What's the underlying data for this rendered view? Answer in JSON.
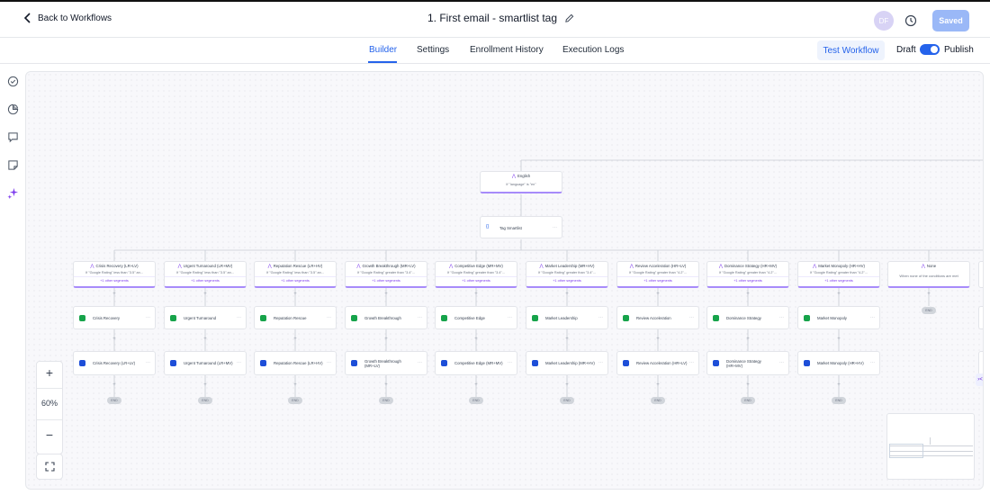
{
  "header": {
    "back_label": "Back to Workflows",
    "title": "1. First email - smartlist tag",
    "avatar_initials": "DF",
    "saved_label": "Saved"
  },
  "tabs": [
    "Builder",
    "Settings",
    "Enrollment History",
    "Execution Logs"
  ],
  "active_tab": "Builder",
  "toolbar": {
    "test_label": "Test Workflow",
    "draft_label": "Draft",
    "publish_label": "Publish",
    "publish_toggle_on": true
  },
  "sidebar_icons": [
    "check-circle-icon",
    "pie-chart-icon",
    "comment-icon",
    "note-icon",
    "sparkle-icon"
  ],
  "colors": {
    "accent": "#2563eb",
    "condition_accent": "#a78bfa",
    "action_green": "#16a34a",
    "tag_blue": "#1d4ed8",
    "saved_button": "#9ab8f7"
  },
  "canvas": {
    "top_condition": {
      "title": "English",
      "subtitle": "If \"language\" is \"en\""
    },
    "top_action": {
      "label": "Tag Smartlist"
    },
    "more_segments_label": "+1 other segments",
    "end_label": "END",
    "branches": [
      {
        "title": "Crisis Recovery (LR+LV)",
        "subtitle": "If \"Google Rating\" less than \"3.5\" an...",
        "action": "Crisis Recovery",
        "tag": "Crisis Recovery (LR+LV)"
      },
      {
        "title": "Urgent Turnaround (LR+MV)",
        "subtitle": "If \"Google Rating\" less than \"3.5\" an...",
        "action": "Urgent Turnaround",
        "tag": "Urgent Turnaround (LR+MV)"
      },
      {
        "title": "Reputation Rescue (LR+HV)",
        "subtitle": "If \"Google Rating\" less than \"3.5\" an...",
        "action": "Reputation Rescue",
        "tag": "Reputation Rescue (LR+HV)"
      },
      {
        "title": "Growth Breakthrough (MR+LV)",
        "subtitle": "If \"Google Rating\" greater than \"3.4\"...",
        "action": "Growth Breakthrough",
        "tag": "Growth Breakthrough (MR+LV)"
      },
      {
        "title": "Competitive Edge (MR+MV)",
        "subtitle": "If \"Google Rating\" greater than \"3.4\"...",
        "action": "Competitive Edge",
        "tag": "Competitive Edge (MR+MV)"
      },
      {
        "title": "Market Leadership (MR+HV)",
        "subtitle": "If \"Google Rating\" greater than \"3.4\"...",
        "action": "Market Leadership",
        "tag": "Market Leadership (MR+HV)"
      },
      {
        "title": "Review Acceleration (HR+LV)",
        "subtitle": "If \"Google Rating\" greater than \"4.2\"...",
        "action": "Review Acceleration",
        "tag": "Review Acceleration (HR+LV)"
      },
      {
        "title": "Dominance Strategy (HR+MV)",
        "subtitle": "If \"Google Rating\" greater than \"4.2\"...",
        "action": "Dominance Strategy",
        "tag": "Dominance Strategy (HR+MV)"
      },
      {
        "title": "Market Monopoly (HR+HV)",
        "subtitle": "If \"Google Rating\" greater than \"4.2\"...",
        "action": "Market Monopoly",
        "tag": "Market Monopoly (HR+HV)"
      }
    ],
    "none_branch": {
      "title": "None",
      "subtitle": "When none of the conditions are met"
    }
  },
  "zoom": {
    "plus": "+",
    "level": "60%",
    "minus": "−"
  }
}
